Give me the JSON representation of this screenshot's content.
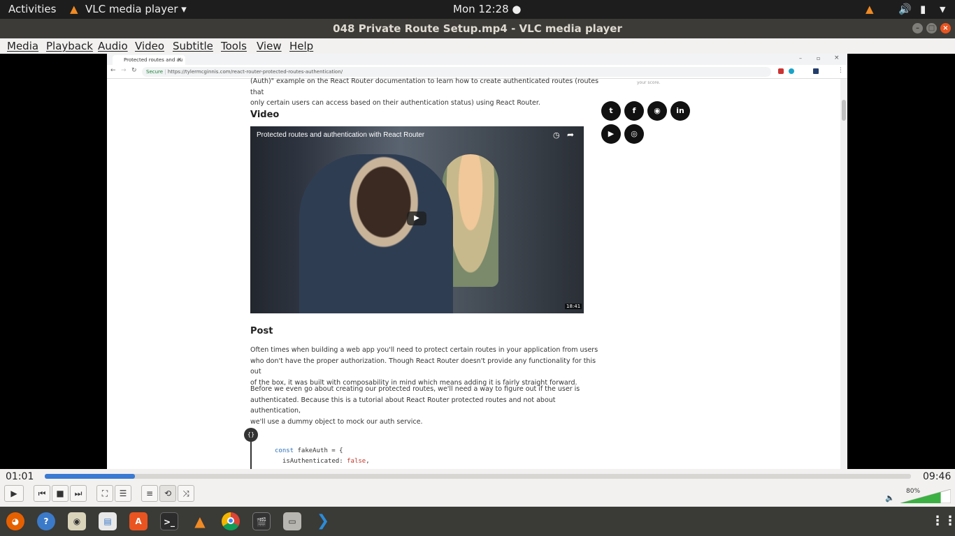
{
  "topbar": {
    "activities": "Activities",
    "app_menu": "VLC media player",
    "clock": "Mon 12:28"
  },
  "window": {
    "title": "048 Private Route Setup.mp4 - VLC media player"
  },
  "menu": [
    "Media",
    "Playback",
    "Audio",
    "Video",
    "Subtitle",
    "Tools",
    "View",
    "Help"
  ],
  "browser": {
    "tab_title": "Protected routes and au",
    "url_secure": "Secure",
    "url": "https://tylermcginnis.com/react-router-protected-routes-authentication/"
  },
  "page": {
    "intro_line1": "(Auth)\" example on the React Router documentation to learn how to create authenticated routes (routes that",
    "intro_line2": "only certain users can access based on their authentication status) using React Router.",
    "score": "your score.",
    "video_heading": "Video",
    "video_title": "Protected routes and authentication with React Router",
    "video_duration": "18:41",
    "post_heading": "Post",
    "p1_l1": "Often times when building a web app you'll need to protect certain routes in your application from users",
    "p1_l2": "who don't have the proper authorization. Though React Router doesn't provide any functionality for this out",
    "p1_l3": "of the box, it was built with composability in mind which means adding it is fairly straight forward.",
    "p2_l1": "Before we even go about creating our protected routes, we'll need a way to figure out if the user is",
    "p2_l2": "authenticated. Because this is a tutorial about React Router protected routes and not about authentication,",
    "p2_l3": "we'll use a dummy object to mock our auth service.",
    "code_badge": "{}",
    "code_l1_kw": "const",
    "code_l1_rest": " fakeAuth = {",
    "code_l2_key": "isAuthenticated",
    "code_l2_val": "false",
    "social": [
      "twitter-icon",
      "facebook-icon",
      "github-icon",
      "linkedin-icon",
      "youtube-icon",
      "instagram-icon"
    ]
  },
  "player": {
    "elapsed": "01:01",
    "total": "09:46",
    "progress": 0.104,
    "volume_label": "80%",
    "volume": 0.8
  }
}
